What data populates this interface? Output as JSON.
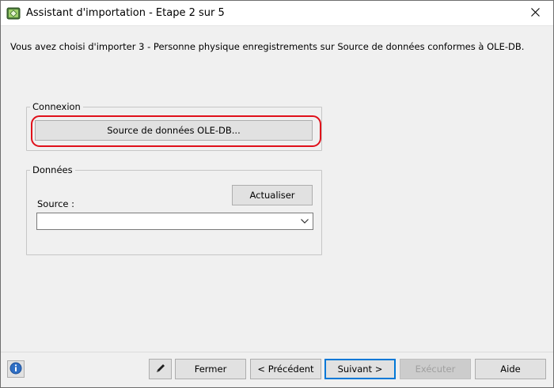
{
  "window": {
    "title": "Assistant d'importation - Etape 2 sur 5",
    "icons": {
      "app": "import-wizard-icon",
      "close": "close-icon"
    }
  },
  "info": {
    "text": "Vous avez choisi d'importer 3 - Personne physique enregistrements sur Source de données conformes à OLE-DB."
  },
  "connexion": {
    "legend": "Connexion",
    "button_label": "Source de données OLE-DB..."
  },
  "donnees": {
    "legend": "Données",
    "refresh_label": "Actualiser",
    "source_label": "Source :",
    "source_value": ""
  },
  "footer": {
    "icons": {
      "info": "info-icon",
      "edit": "pen-icon"
    },
    "close_label": "Fermer",
    "previous_label": "< Précédent",
    "next_label": "Suivant >",
    "execute_label": "Exécuter",
    "help_label": "Aide"
  },
  "colors": {
    "highlight": "#e0101a",
    "accent": "#0078d7"
  }
}
